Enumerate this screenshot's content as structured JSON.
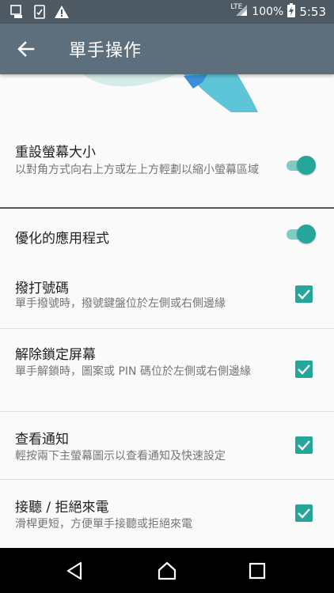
{
  "status_bar": {
    "network": "LTE",
    "battery": "100%",
    "time": "5:53",
    "icons": [
      "screenshot-icon",
      "clipboard-check-icon",
      "warning-icon",
      "signal-icon",
      "battery-charging-icon"
    ]
  },
  "app_bar": {
    "title": "單手操作",
    "back_icon": "arrow-back-icon"
  },
  "settings": {
    "resize": {
      "title": "重設螢幕大小",
      "subtitle": "以對角方式向右上方或左上方輕劃以縮小螢幕區域",
      "enabled": true
    },
    "optimized_apps": {
      "title": "優化的應用程式",
      "enabled": true
    },
    "dial": {
      "title": "撥打號碼",
      "subtitle": "單手撥號時，撥號鍵盤位於左側或右側邊緣",
      "checked": true
    },
    "unlock": {
      "title": "解除鎖定屏幕",
      "subtitle": "單手解鎖時，圖案或 PIN 碼位於左側或右側邊緣",
      "checked": true
    },
    "notifications": {
      "title": "查看通知",
      "subtitle": "輕按兩下主螢幕圖示以查看通知及快速設定",
      "checked": true
    },
    "calls": {
      "title": "接聽 / 拒絕來電",
      "subtitle": "滑桿更短，方便單手接聽或拒絕來電",
      "checked": true
    }
  },
  "nav_bar": {
    "back": "nav-back-icon",
    "home": "nav-home-icon",
    "recents": "nav-recents-icon"
  },
  "colors": {
    "accent": "#26a69a",
    "app_bar": "#5d6f7c",
    "status_bar": "#4d5a64"
  }
}
